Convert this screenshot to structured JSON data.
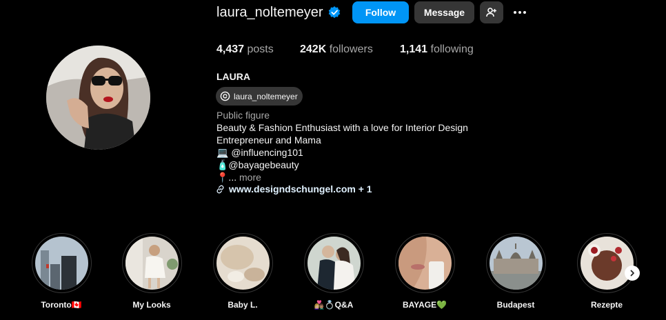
{
  "profile": {
    "username": "laura_noltemeyer",
    "verified_icon": "verified-badge-icon",
    "follow_label": "Follow",
    "message_label": "Message",
    "suggest_icon": "add-person-icon",
    "more_icon": "more-options-icon",
    "posts_count": "4,437",
    "posts_label": "posts",
    "followers_count": "242K",
    "followers_label": "followers",
    "following_count": "1,141",
    "following_label": "following",
    "full_name": "LAURA",
    "threads_handle": "laura_noltemeyer",
    "category": "Public figure",
    "bio": {
      "line1": "Beauty & Fashion Enthusiast with a love for Interior Design",
      "line2": "Entrepreneur and Mama",
      "line3": "💻 @influencing101",
      "line4": "🧴@bayagebeauty",
      "line5_prefix": "📍...",
      "line5_more": "more"
    },
    "link": "www.designdschungel.com + 1"
  },
  "highlights": [
    {
      "label": "Toronto🇨🇦"
    },
    {
      "label": "My Looks"
    },
    {
      "label": "Baby L."
    },
    {
      "label": "👩🏼‍❤️‍👨🏽💍Q&A"
    },
    {
      "label": "BAYAGE💚"
    },
    {
      "label": "Budapest"
    },
    {
      "label": "Rezepte"
    }
  ],
  "colors": {
    "background": "#000000",
    "follow_button": "#0095f6",
    "secondary_button": "#363636",
    "muted_text": "#a8a8a8",
    "link_text": "#e0f1ff"
  }
}
